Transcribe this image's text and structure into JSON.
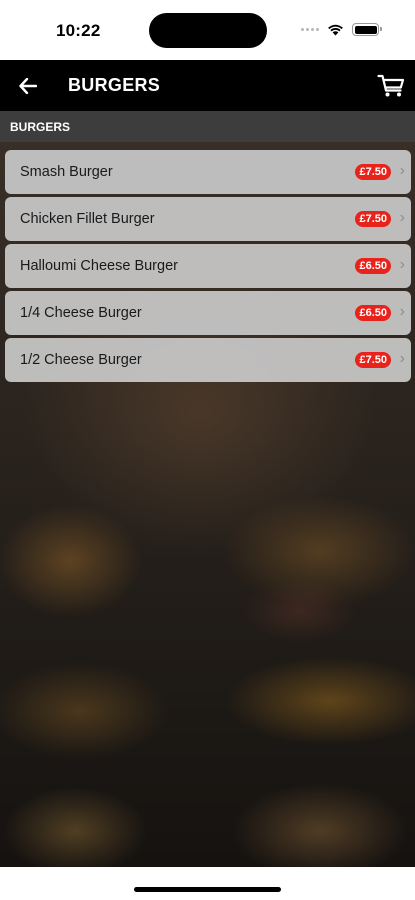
{
  "status_bar": {
    "time": "10:22"
  },
  "nav": {
    "title": "BURGERS"
  },
  "section": {
    "label": "BURGERS"
  },
  "menu_items": [
    {
      "name": "Smash Burger",
      "price": "£7.50"
    },
    {
      "name": "Chicken Fillet Burger",
      "price": "£7.50"
    },
    {
      "name": "Halloumi Cheese Burger",
      "price": "£6.50"
    },
    {
      "name": "1/4 Cheese Burger",
      "price": "£6.50"
    },
    {
      "name": "1/2 Cheese Burger",
      "price": "£7.50"
    }
  ],
  "icons": {
    "back": "arrow-left-icon",
    "cart": "shopping-cart-icon",
    "chevron": "chevron-right-icon"
  },
  "colors": {
    "nav_background": "#000000",
    "section_background": "#3d3d3d",
    "price_badge": "#e8231c",
    "menu_item": "#cacaca"
  }
}
